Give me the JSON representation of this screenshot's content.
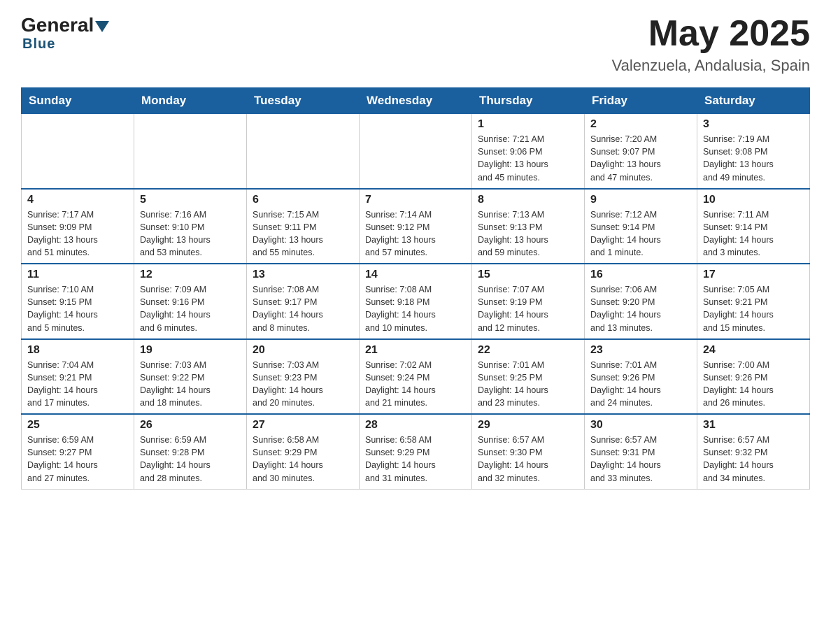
{
  "header": {
    "logo_general": "General",
    "logo_blue": "Blue",
    "month_title": "May 2025",
    "location": "Valenzuela, Andalusia, Spain"
  },
  "days_of_week": [
    "Sunday",
    "Monday",
    "Tuesday",
    "Wednesday",
    "Thursday",
    "Friday",
    "Saturday"
  ],
  "weeks": [
    [
      {
        "day": "",
        "info": ""
      },
      {
        "day": "",
        "info": ""
      },
      {
        "day": "",
        "info": ""
      },
      {
        "day": "",
        "info": ""
      },
      {
        "day": "1",
        "info": "Sunrise: 7:21 AM\nSunset: 9:06 PM\nDaylight: 13 hours\nand 45 minutes."
      },
      {
        "day": "2",
        "info": "Sunrise: 7:20 AM\nSunset: 9:07 PM\nDaylight: 13 hours\nand 47 minutes."
      },
      {
        "day": "3",
        "info": "Sunrise: 7:19 AM\nSunset: 9:08 PM\nDaylight: 13 hours\nand 49 minutes."
      }
    ],
    [
      {
        "day": "4",
        "info": "Sunrise: 7:17 AM\nSunset: 9:09 PM\nDaylight: 13 hours\nand 51 minutes."
      },
      {
        "day": "5",
        "info": "Sunrise: 7:16 AM\nSunset: 9:10 PM\nDaylight: 13 hours\nand 53 minutes."
      },
      {
        "day": "6",
        "info": "Sunrise: 7:15 AM\nSunset: 9:11 PM\nDaylight: 13 hours\nand 55 minutes."
      },
      {
        "day": "7",
        "info": "Sunrise: 7:14 AM\nSunset: 9:12 PM\nDaylight: 13 hours\nand 57 minutes."
      },
      {
        "day": "8",
        "info": "Sunrise: 7:13 AM\nSunset: 9:13 PM\nDaylight: 13 hours\nand 59 minutes."
      },
      {
        "day": "9",
        "info": "Sunrise: 7:12 AM\nSunset: 9:14 PM\nDaylight: 14 hours\nand 1 minute."
      },
      {
        "day": "10",
        "info": "Sunrise: 7:11 AM\nSunset: 9:14 PM\nDaylight: 14 hours\nand 3 minutes."
      }
    ],
    [
      {
        "day": "11",
        "info": "Sunrise: 7:10 AM\nSunset: 9:15 PM\nDaylight: 14 hours\nand 5 minutes."
      },
      {
        "day": "12",
        "info": "Sunrise: 7:09 AM\nSunset: 9:16 PM\nDaylight: 14 hours\nand 6 minutes."
      },
      {
        "day": "13",
        "info": "Sunrise: 7:08 AM\nSunset: 9:17 PM\nDaylight: 14 hours\nand 8 minutes."
      },
      {
        "day": "14",
        "info": "Sunrise: 7:08 AM\nSunset: 9:18 PM\nDaylight: 14 hours\nand 10 minutes."
      },
      {
        "day": "15",
        "info": "Sunrise: 7:07 AM\nSunset: 9:19 PM\nDaylight: 14 hours\nand 12 minutes."
      },
      {
        "day": "16",
        "info": "Sunrise: 7:06 AM\nSunset: 9:20 PM\nDaylight: 14 hours\nand 13 minutes."
      },
      {
        "day": "17",
        "info": "Sunrise: 7:05 AM\nSunset: 9:21 PM\nDaylight: 14 hours\nand 15 minutes."
      }
    ],
    [
      {
        "day": "18",
        "info": "Sunrise: 7:04 AM\nSunset: 9:21 PM\nDaylight: 14 hours\nand 17 minutes."
      },
      {
        "day": "19",
        "info": "Sunrise: 7:03 AM\nSunset: 9:22 PM\nDaylight: 14 hours\nand 18 minutes."
      },
      {
        "day": "20",
        "info": "Sunrise: 7:03 AM\nSunset: 9:23 PM\nDaylight: 14 hours\nand 20 minutes."
      },
      {
        "day": "21",
        "info": "Sunrise: 7:02 AM\nSunset: 9:24 PM\nDaylight: 14 hours\nand 21 minutes."
      },
      {
        "day": "22",
        "info": "Sunrise: 7:01 AM\nSunset: 9:25 PM\nDaylight: 14 hours\nand 23 minutes."
      },
      {
        "day": "23",
        "info": "Sunrise: 7:01 AM\nSunset: 9:26 PM\nDaylight: 14 hours\nand 24 minutes."
      },
      {
        "day": "24",
        "info": "Sunrise: 7:00 AM\nSunset: 9:26 PM\nDaylight: 14 hours\nand 26 minutes."
      }
    ],
    [
      {
        "day": "25",
        "info": "Sunrise: 6:59 AM\nSunset: 9:27 PM\nDaylight: 14 hours\nand 27 minutes."
      },
      {
        "day": "26",
        "info": "Sunrise: 6:59 AM\nSunset: 9:28 PM\nDaylight: 14 hours\nand 28 minutes."
      },
      {
        "day": "27",
        "info": "Sunrise: 6:58 AM\nSunset: 9:29 PM\nDaylight: 14 hours\nand 30 minutes."
      },
      {
        "day": "28",
        "info": "Sunrise: 6:58 AM\nSunset: 9:29 PM\nDaylight: 14 hours\nand 31 minutes."
      },
      {
        "day": "29",
        "info": "Sunrise: 6:57 AM\nSunset: 9:30 PM\nDaylight: 14 hours\nand 32 minutes."
      },
      {
        "day": "30",
        "info": "Sunrise: 6:57 AM\nSunset: 9:31 PM\nDaylight: 14 hours\nand 33 minutes."
      },
      {
        "day": "31",
        "info": "Sunrise: 6:57 AM\nSunset: 9:32 PM\nDaylight: 14 hours\nand 34 minutes."
      }
    ]
  ]
}
